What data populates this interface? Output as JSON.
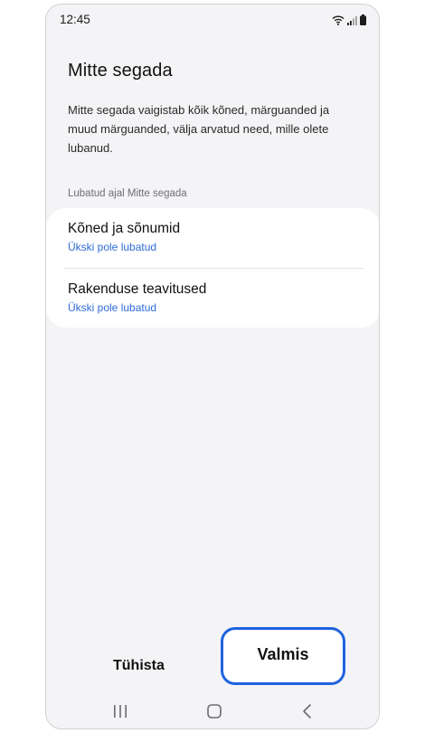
{
  "status_bar": {
    "time": "12:45",
    "icons": [
      "wifi-icon",
      "signal-icon",
      "battery-icon"
    ]
  },
  "page": {
    "title": "Mitte segada",
    "description": "Mitte segada vaigistab kõik kõned, märguanded ja muud märguanded, välja arvatud need, mille olete lubanud."
  },
  "allowed_section": {
    "header": "Lubatud ajal Mitte segada",
    "items": [
      {
        "title": "Kõned ja sõnumid",
        "subtitle": "Ükski pole lubatud"
      },
      {
        "title": "Rakenduse teavitused",
        "subtitle": "Ükski pole lubatud"
      }
    ]
  },
  "actions": {
    "cancel_label": "Tühista",
    "done_label": "Valmis"
  },
  "nav_bar": {
    "icons": [
      "recents-icon",
      "home-icon",
      "back-icon"
    ]
  },
  "colors": {
    "background": "#f4f4f6",
    "card": "#ffffff",
    "link_blue": "#2f6bd8",
    "highlight": "#1f63e0"
  }
}
